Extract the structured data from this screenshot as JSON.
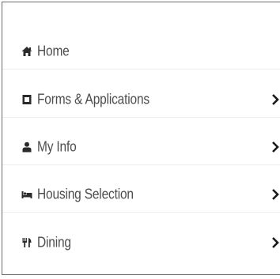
{
  "colors": {
    "text": "#4d4d4d",
    "icon": "#2b2b2b",
    "chevron": "#1a1a1a",
    "border": "#6b6b6b"
  },
  "nav": {
    "items": [
      {
        "label": "Home",
        "icon": "home-icon",
        "has_submenu": false
      },
      {
        "label": "Forms & Applications",
        "icon": "form-icon",
        "has_submenu": true
      },
      {
        "label": "My Info",
        "icon": "user-icon",
        "has_submenu": true
      },
      {
        "label": "Housing Selection",
        "icon": "bed-icon",
        "has_submenu": true
      },
      {
        "label": "Dining",
        "icon": "utensils-icon",
        "has_submenu": true
      }
    ]
  }
}
